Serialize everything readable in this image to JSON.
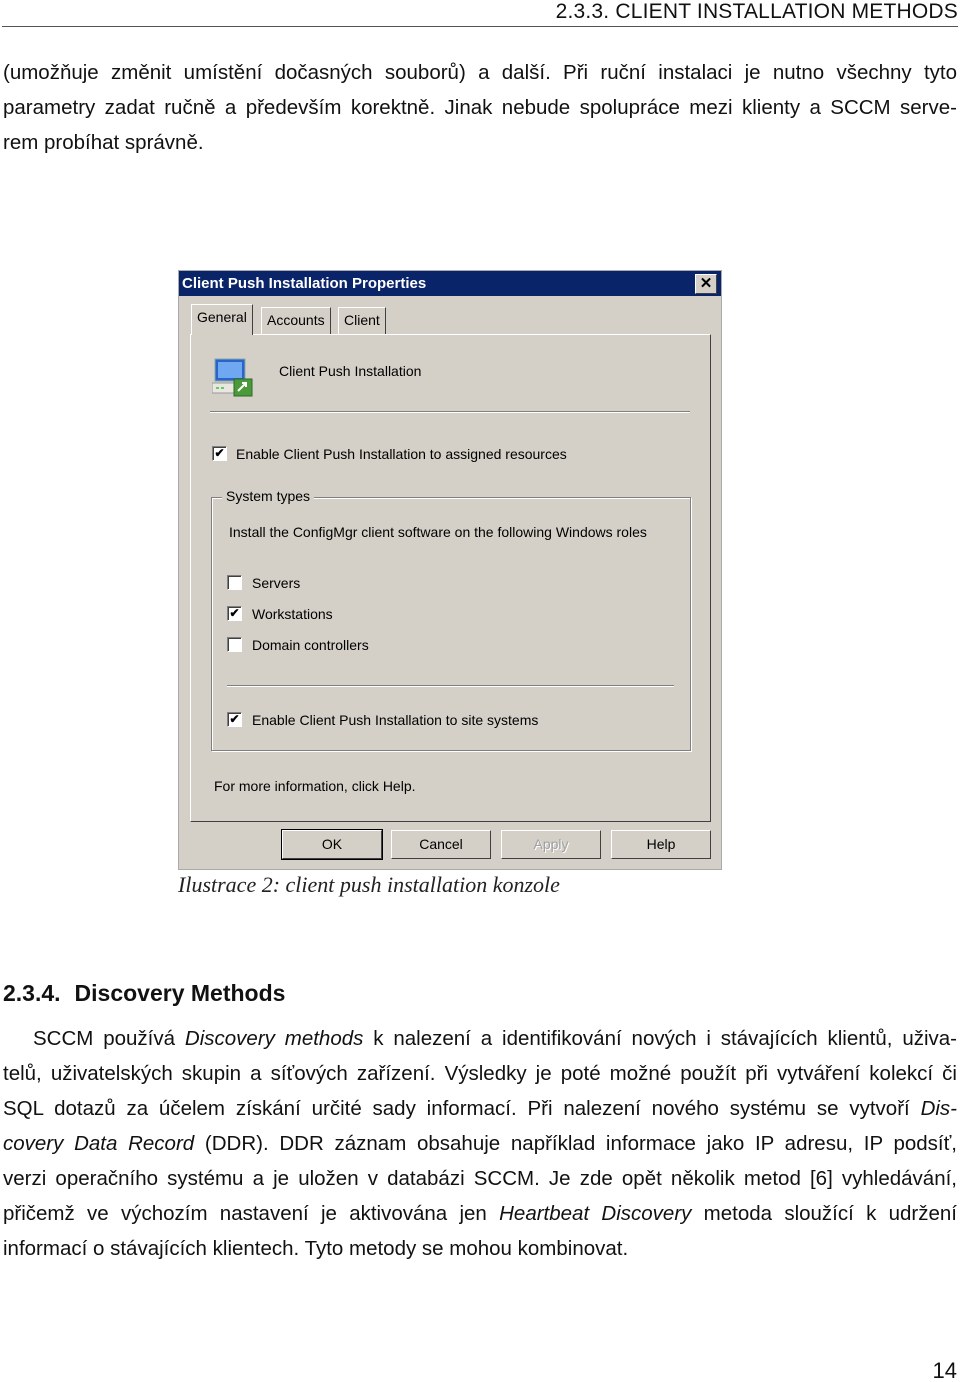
{
  "running_head": "2.3.3. CLIENT INSTALLATION METHODS",
  "para1": [
    [
      {
        "t": "(umožňuje změnit umístění dočasných souborů) a další. Při ruční instalaci je nutno všechny tyto"
      }
    ],
    [
      {
        "t": "parametry zadat ručně a především korektně. Jinak nebude spolupráce mezi klienty a SCCM serve-"
      }
    ],
    [
      {
        "t": "rem probíhat správně."
      }
    ]
  ],
  "dialog": {
    "title": "Client Push Installation Properties",
    "close_glyph": "✕",
    "tabs": [
      "General",
      "Accounts",
      "Client"
    ],
    "header_text": "Client Push Installation",
    "enable_assigned": {
      "label": "Enable Client Push Installation to assigned resources",
      "checked": true
    },
    "group_label": "System types",
    "group_desc": "Install the ConfigMgr client software on the following Windows roles",
    "roles": [
      {
        "label": "Servers",
        "checked": false
      },
      {
        "label": "Workstations",
        "checked": true
      },
      {
        "label": "Domain controllers",
        "checked": false
      }
    ],
    "enable_site": {
      "label": "Enable Client Push Installation to site systems",
      "checked": true
    },
    "info": "For more information, click Help.",
    "buttons": {
      "ok": "OK",
      "cancel": "Cancel",
      "apply": "Apply",
      "help": "Help"
    }
  },
  "caption": "Ilustrace 2: client push installation konzole",
  "heading": {
    "number": "2.3.4.",
    "title": "Discovery Methods"
  },
  "para2": [
    [
      {
        "t": "SCCM používá "
      },
      {
        "t": "Discovery methods",
        "i": true
      },
      {
        "t": " k nalezení a identifikování nových i stávajících klientů, uživa-"
      }
    ],
    [
      {
        "t": "telů, uživatelských skupin a síťových zařízení. Výsledky je poté možné použít při vytváření kolekcí či"
      }
    ],
    [
      {
        "t": "SQL dotazů za účelem získání určité sady informací. Při nalezení nového systému se vytvoří "
      },
      {
        "t": "Dis-",
        "i": true
      }
    ],
    [
      {
        "t": "covery Data Record",
        "i": true
      },
      {
        "t": " (DDR). DDR záznam obsahuje například informace jako IP adresu, IP podsíť,"
      }
    ],
    [
      {
        "t": "verzi operačního systému a je uložen v databázi SCCM. Je zde opět několik metod [6] vyhledávání,"
      }
    ],
    [
      {
        "t": "přičemž ve výchozím nastavení je aktivována jen "
      },
      {
        "t": "Heartbeat Discovery",
        "i": true
      },
      {
        "t": " metoda sloužící k udržení"
      }
    ],
    [
      {
        "t": "informací o stávajících klientech. Tyto metody se mohou kombinovat."
      }
    ]
  ],
  "page_number": "14"
}
